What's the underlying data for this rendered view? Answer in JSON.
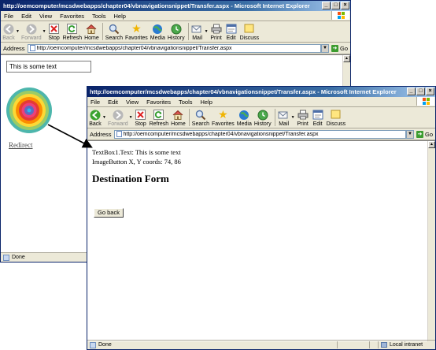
{
  "window1": {
    "title": "http://oemcomputer/mcsdwebapps/chapter04/vbnavigationsnippet/Transfer.aspx - Microsoft Internet Explorer",
    "menu": [
      "File",
      "Edit",
      "View",
      "Favorites",
      "Tools",
      "Help"
    ],
    "toolbar": {
      "back": "Back",
      "forward": "Forward",
      "stop": "Stop",
      "refresh": "Refresh",
      "home": "Home",
      "search": "Search",
      "favorites": "Favorites",
      "media": "Media",
      "history": "History",
      "mail": "Mail",
      "print": "Print",
      "edit": "Edit",
      "discuss": "Discuss"
    },
    "address_label": "Address",
    "url": "http://oemcomputer/mcsdwebapps/chapter04/vbnavigationsnippet/Transfer.aspx",
    "go": "Go",
    "textbox_value": "This is some text",
    "link": "Redirect",
    "status": "Done"
  },
  "window2": {
    "title": "http://oemcomputer/mcsdwebapps/chapter04/vbnavigationsnippet/Transfer.aspx - Microsoft Internet Explorer",
    "menu": [
      "File",
      "Edit",
      "View",
      "Favorites",
      "Tools",
      "Help"
    ],
    "toolbar": {
      "back": "Back",
      "forward": "Forward",
      "stop": "Stop",
      "refresh": "Refresh",
      "home": "Home",
      "search": "Search",
      "favorites": "Favorites",
      "media": "Media",
      "history": "History",
      "mail": "Mail",
      "print": "Print",
      "edit": "Edit",
      "discuss": "Discuss"
    },
    "address_label": "Address",
    "url": "http://oemcomputer/mcsdwebapps/chapter04/vbnavigationsnippet/Transfer.aspx",
    "go": "Go",
    "line1": "TextBox1.Text: This is some text",
    "line2": "ImageButton X, Y coords: 74, 86",
    "heading": "Destination Form",
    "button": "Go back",
    "status": "Done",
    "zone": "Local intranet"
  }
}
